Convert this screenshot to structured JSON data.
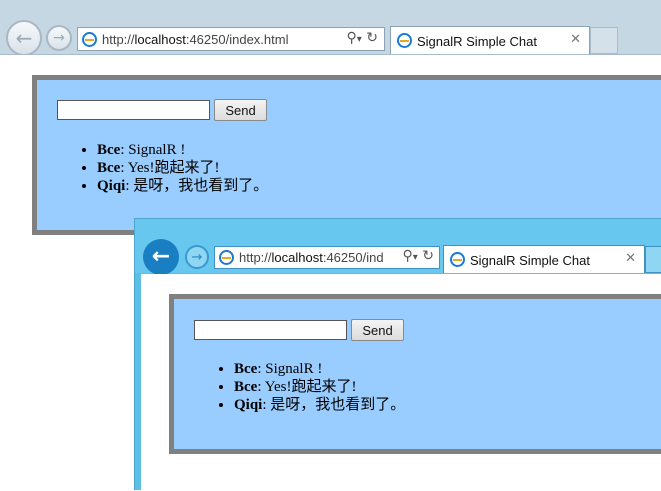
{
  "windows": [
    {
      "address": {
        "url_prefix": "http://",
        "url_host": "localhost",
        "url_rest": ":46250/index.html"
      },
      "tab": {
        "title": "SignalR Simple Chat"
      },
      "chat": {
        "input_value": "",
        "send_label": "Send",
        "messages": [
          {
            "name": "Bce",
            "text": ":  SignalR !"
          },
          {
            "name": "Bce",
            "text": ":  Yes!跑起来了!"
          },
          {
            "name": "Qiqi",
            "text": ":  是呀，我也看到了。"
          }
        ]
      }
    },
    {
      "address": {
        "url_prefix": "http://",
        "url_host": "localhost",
        "url_rest": ":46250/ind"
      },
      "tab": {
        "title": "SignalR Simple Chat"
      },
      "chat": {
        "input_value": "",
        "send_label": "Send",
        "messages": [
          {
            "name": "Bce",
            "text": ":  SignalR !"
          },
          {
            "name": "Bce",
            "text": ":  Yes!跑起来了!"
          },
          {
            "name": "Qiqi",
            "text": ":  是呀，我也看到了。"
          }
        ]
      }
    }
  ],
  "icons": {
    "back": "back-arrow-icon",
    "forward": "forward-arrow-icon",
    "search": "search-icon",
    "dropdown": "dropdown-icon",
    "refresh": "refresh-icon",
    "close": "close-icon",
    "site": "ie-page-icon"
  },
  "colors": {
    "panel_background": "#99ccff",
    "panel_border": "#808080",
    "chrome_inactive": "#c5d7e3",
    "chrome_active": "#67c7ee",
    "back_button_active": "#1a7fc2"
  }
}
